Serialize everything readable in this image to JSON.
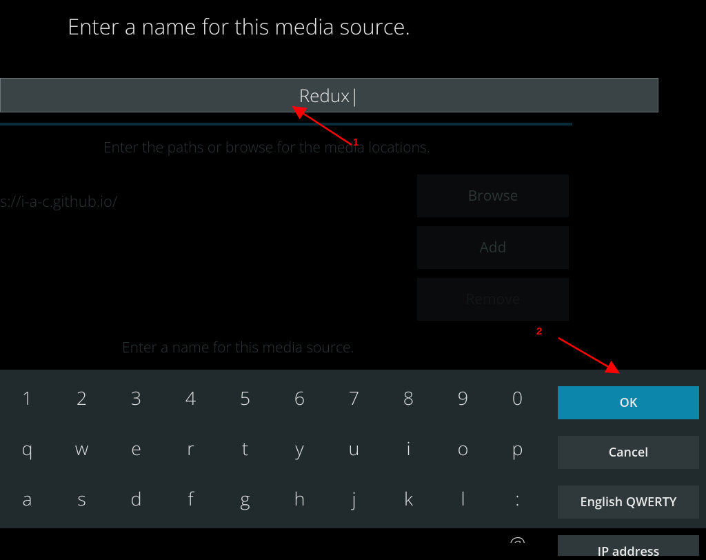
{
  "title": "Enter a name for this media source.",
  "input_value": "Redux",
  "cursor": "|",
  "background": {
    "heading1": "Enter the paths or browse for the media locations.",
    "path_value": "s://i-a-c.github.io/",
    "browse": "Browse",
    "add": "Add",
    "remove": "Remove",
    "heading2": "Enter a name for this media source."
  },
  "keyboard": {
    "row1": [
      "1",
      "2",
      "3",
      "4",
      "5",
      "6",
      "7",
      "8",
      "9",
      "0"
    ],
    "row2": [
      "q",
      "w",
      "e",
      "r",
      "t",
      "y",
      "u",
      "i",
      "o",
      "p"
    ],
    "row3": [
      "a",
      "s",
      "d",
      "f",
      "g",
      "h",
      "j",
      "k",
      "l",
      ":"
    ],
    "row4_partial": [
      "",
      "",
      "",
      "",
      "",
      "",
      "",
      "",
      "",
      "@"
    ]
  },
  "side": {
    "ok": "OK",
    "cancel": "Cancel",
    "layout": "English QWERTY",
    "ip": "IP address"
  },
  "annotations": {
    "n1": "1",
    "n2": "2"
  }
}
